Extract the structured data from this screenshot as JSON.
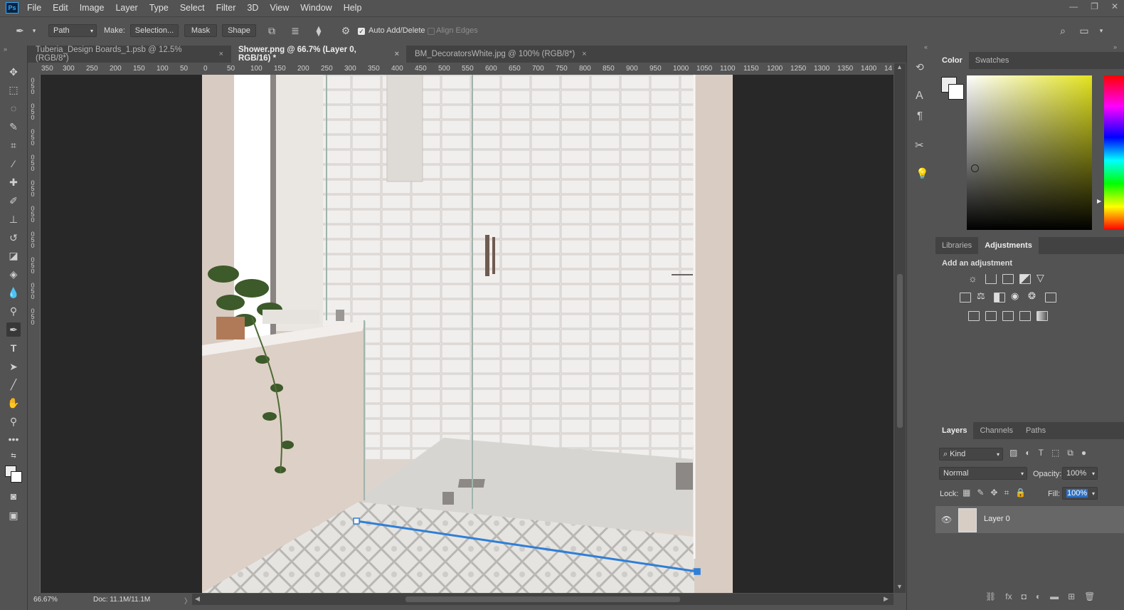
{
  "app": {
    "logo": "Ps"
  },
  "menu": [
    "File",
    "Edit",
    "Image",
    "Layer",
    "Type",
    "Select",
    "Filter",
    "3D",
    "View",
    "Window",
    "Help"
  ],
  "window_controls": [
    "—",
    "❐",
    "✕"
  ],
  "options": {
    "mode_value": "Path",
    "make_label": "Make:",
    "selection_label": "Selection...",
    "mask_label": "Mask",
    "shape_label": "Shape",
    "auto_add_label": "Auto Add/Delete",
    "align_edges_label": "Align Edges"
  },
  "tabs": [
    {
      "label": "Tuberia_Design Boards_1.psb @ 12.5% (RGB/8*)",
      "close": "×"
    },
    {
      "label": "Shower.png @ 66.7% (Layer 0, RGB/16) *",
      "close": "×"
    },
    {
      "label": "BM_DecoratorsWhite.jpg @ 100% (RGB/8*)",
      "close": "×"
    }
  ],
  "hruler_ticks": [
    "350",
    "300",
    "250",
    "200",
    "150",
    "100",
    "50",
    "0",
    "50",
    "100",
    "150",
    "200",
    "250",
    "300",
    "350",
    "400",
    "450",
    "500",
    "550",
    "600",
    "650",
    "700",
    "750",
    "800",
    "850",
    "900",
    "950",
    "1000",
    "1050",
    "1100",
    "1150",
    "1200",
    "1250",
    "1300",
    "1350",
    "1400",
    "14"
  ],
  "vruler_ticks": [
    "0",
    "5",
    "0",
    "0",
    "5",
    "0",
    "0",
    "5",
    "0",
    "0",
    "5",
    "0",
    "0",
    "5",
    "0",
    "0",
    "5",
    "0",
    "0",
    "5",
    "0",
    "0",
    "5",
    "0",
    "0",
    "5",
    "0",
    "0",
    "5",
    "0"
  ],
  "status": {
    "zoom": "66.67%",
    "doc": "Doc: 11.1M/11.1M"
  },
  "color_panel": {
    "tab_color": "Color",
    "tab_swatches": "Swatches",
    "hue_color": "#e3e31f"
  },
  "adjustments_panel": {
    "tab_libraries": "Libraries",
    "tab_adjustments": "Adjustments",
    "heading": "Add an adjustment"
  },
  "layers_panel": {
    "tab_layers": "Layers",
    "tab_channels": "Channels",
    "tab_paths": "Paths",
    "kind_label": "Kind",
    "blend_mode": "Normal",
    "opacity_label": "Opacity:",
    "opacity_value": "100%",
    "lock_label": "Lock:",
    "fill_label": "Fill:",
    "fill_value": "100%",
    "layers": [
      {
        "name": "Layer 0"
      }
    ]
  }
}
